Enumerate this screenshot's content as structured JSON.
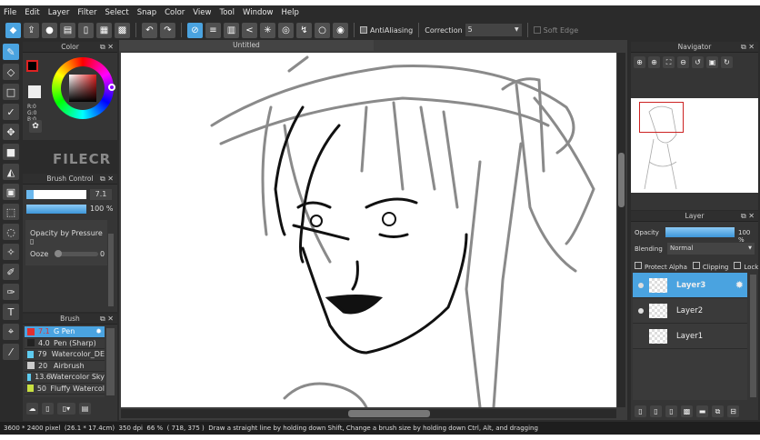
{
  "menu": [
    "File",
    "Edit",
    "Layer",
    "Filter",
    "Select",
    "Snap",
    "Color",
    "View",
    "Tool",
    "Window",
    "Help"
  ],
  "toolbar": {
    "antialiasing": "AntiAliasing",
    "correction_label": "Correction",
    "correction_value": "5",
    "soft_edge": "Soft Edge"
  },
  "document_title": "Untitled",
  "color_panel": {
    "title": "Color",
    "r": "R:0",
    "g": "G:0",
    "b": "B:0",
    "primary": "#000000",
    "secondary": "#ffffff"
  },
  "watermark": "FILECR",
  "brush_control": {
    "title": "Brush Control",
    "size": "7.1",
    "opacity": "100 %",
    "opacity_fraction": 1.0,
    "option": "Opacity by Pressure",
    "ooze_label": "Ooze",
    "ooze_value": "0"
  },
  "brush": {
    "title": "Brush",
    "items": [
      {
        "size": "7.1",
        "name": "G Pen",
        "color": "#e03030"
      },
      {
        "size": "4.0",
        "name": "Pen (Sharp)",
        "color": "#222222"
      },
      {
        "size": "79",
        "name": "Watercolor_DE",
        "color": "#5ecbef"
      },
      {
        "size": "20",
        "name": "Airbrush",
        "color": "#cccccc"
      },
      {
        "size": "13.6",
        "name": "Watercolor Sky",
        "color": "#5ecbef"
      },
      {
        "size": "50",
        "name": "Fluffy Watercol",
        "color": "#c8e040"
      }
    ]
  },
  "navigator": {
    "title": "Navigator"
  },
  "layer_panel": {
    "title": "Layer",
    "opacity_label": "Opacity",
    "opacity_value": "100 %",
    "opacity_fraction": 1.0,
    "blending_label": "Blending",
    "blending_value": "Normal",
    "protect_alpha": "Protect Alpha",
    "clipping": "Clipping",
    "lock": "Lock",
    "layers": [
      {
        "name": "Layer3",
        "visible": true,
        "selected": true
      },
      {
        "name": "Layer2",
        "visible": true,
        "selected": false
      },
      {
        "name": "Layer1",
        "visible": false,
        "selected": false
      }
    ]
  },
  "status": {
    "size": "3600 * 2400 pixel",
    "physical": "(26.1 * 17.4cm)",
    "dpi": "350 dpi",
    "zoom": "66 %",
    "coords": "( 718, 375 )",
    "hint": "Draw a straight line by holding down Shift, Change a brush size by holding down Ctrl, Alt, and dragging"
  }
}
